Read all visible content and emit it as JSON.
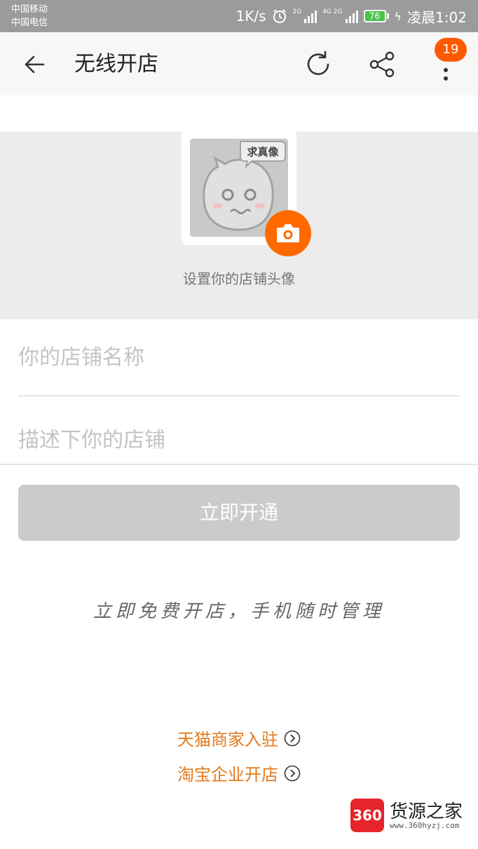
{
  "status_bar": {
    "carrier_1": "中国移动",
    "carrier_2": "中国电信",
    "speed": "1K/s",
    "signal_1_label": "2G",
    "signal_2_label": "4G 2G",
    "battery": "76",
    "time": "凌晨1:02"
  },
  "app_bar": {
    "title": "无线开店",
    "badge_count": "19",
    "icons": [
      "back-arrow-icon",
      "refresh-icon",
      "share-icon",
      "more-vertical-icon"
    ]
  },
  "avatar": {
    "speech_text": "求真像",
    "caption": "设置你的店铺头像"
  },
  "form": {
    "name_placeholder": "你的店铺名称",
    "name_value": "",
    "desc_placeholder": "描述下你的店铺",
    "desc_value": "",
    "submit_label": "立即开通"
  },
  "slogan": "立即免费开店，手机随时管理",
  "links": {
    "tmall": "天猫商家入驻",
    "taobao": "淘宝企业开店"
  },
  "watermark": {
    "logo": "360",
    "title": "货源之家",
    "url": "www.360hyzj.com"
  },
  "colors": {
    "accent": "#ff6a00",
    "link": "#e37a1e",
    "button_disabled": "#cbcbcb",
    "status_bar": "#9b9b9b"
  }
}
